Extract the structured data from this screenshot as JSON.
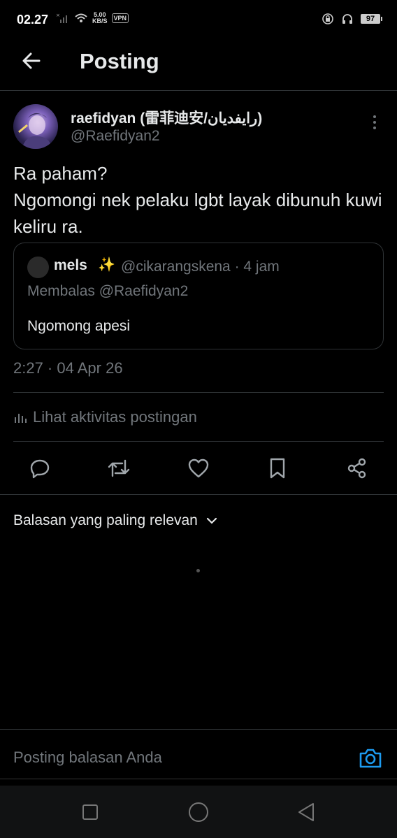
{
  "status_bar": {
    "time": "02.27",
    "speed_value": "5.00",
    "speed_unit": "KB/S",
    "vpn": "VPN",
    "battery": "97"
  },
  "header": {
    "title": "Posting",
    "back_icon": "arrow-left-icon"
  },
  "post": {
    "author_name": "raefidyan (雷菲迪安/رايفديان)",
    "author_handle": "@Raefidyan2",
    "text": "Ra paham?\nNgomongi nek pelaku lgbt layak dibunuh kuwi keliru ra.",
    "timestamp": "2:27 · 04 Apr 26",
    "quoted": {
      "name": "mels",
      "emoji": "✨",
      "handle_time": "@cikarangskena · 4 jam",
      "reply_to": "Membalas @Raefidyan2",
      "text": "Ngomong apesi"
    }
  },
  "activity_label": "Lihat aktivitas postingan",
  "actions": [
    "reply-icon",
    "retweet-icon",
    "like-icon",
    "bookmark-icon",
    "share-icon"
  ],
  "replies_sort": "Balasan yang paling relevan",
  "reply_placeholder": "Posting balasan Anda",
  "colors": {
    "background": "#000000",
    "text": "#e7e9ea",
    "secondary": "#71767b",
    "divider": "#2f3336",
    "accent": "#1d9bf0"
  }
}
